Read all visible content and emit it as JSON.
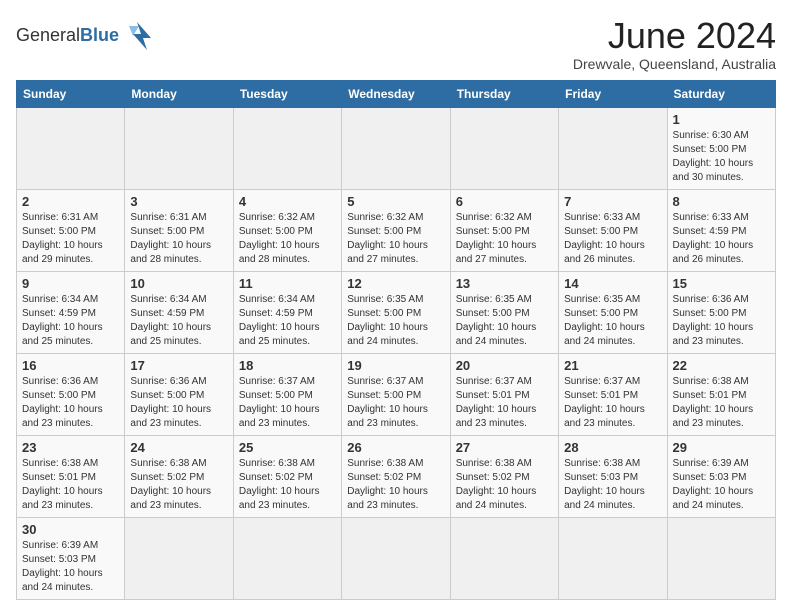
{
  "header": {
    "logo_text_regular": "General",
    "logo_text_bold": "Blue",
    "cal_title": "June 2024",
    "cal_subtitle": "Drewvale, Queensland, Australia"
  },
  "days_of_week": [
    "Sunday",
    "Monday",
    "Tuesday",
    "Wednesday",
    "Thursday",
    "Friday",
    "Saturday"
  ],
  "weeks": [
    [
      {
        "day": "",
        "info": ""
      },
      {
        "day": "",
        "info": ""
      },
      {
        "day": "",
        "info": ""
      },
      {
        "day": "",
        "info": ""
      },
      {
        "day": "",
        "info": ""
      },
      {
        "day": "",
        "info": ""
      },
      {
        "day": "1",
        "info": "Sunrise: 6:30 AM\nSunset: 5:00 PM\nDaylight: 10 hours and 30 minutes."
      }
    ],
    [
      {
        "day": "2",
        "info": "Sunrise: 6:31 AM\nSunset: 5:00 PM\nDaylight: 10 hours and 29 minutes."
      },
      {
        "day": "3",
        "info": "Sunrise: 6:31 AM\nSunset: 5:00 PM\nDaylight: 10 hours and 28 minutes."
      },
      {
        "day": "4",
        "info": "Sunrise: 6:32 AM\nSunset: 5:00 PM\nDaylight: 10 hours and 28 minutes."
      },
      {
        "day": "5",
        "info": "Sunrise: 6:32 AM\nSunset: 5:00 PM\nDaylight: 10 hours and 27 minutes."
      },
      {
        "day": "6",
        "info": "Sunrise: 6:32 AM\nSunset: 5:00 PM\nDaylight: 10 hours and 27 minutes."
      },
      {
        "day": "7",
        "info": "Sunrise: 6:33 AM\nSunset: 5:00 PM\nDaylight: 10 hours and 26 minutes."
      },
      {
        "day": "8",
        "info": "Sunrise: 6:33 AM\nSunset: 4:59 PM\nDaylight: 10 hours and 26 minutes."
      }
    ],
    [
      {
        "day": "9",
        "info": "Sunrise: 6:34 AM\nSunset: 4:59 PM\nDaylight: 10 hours and 25 minutes."
      },
      {
        "day": "10",
        "info": "Sunrise: 6:34 AM\nSunset: 4:59 PM\nDaylight: 10 hours and 25 minutes."
      },
      {
        "day": "11",
        "info": "Sunrise: 6:34 AM\nSunset: 4:59 PM\nDaylight: 10 hours and 25 minutes."
      },
      {
        "day": "12",
        "info": "Sunrise: 6:35 AM\nSunset: 5:00 PM\nDaylight: 10 hours and 24 minutes."
      },
      {
        "day": "13",
        "info": "Sunrise: 6:35 AM\nSunset: 5:00 PM\nDaylight: 10 hours and 24 minutes."
      },
      {
        "day": "14",
        "info": "Sunrise: 6:35 AM\nSunset: 5:00 PM\nDaylight: 10 hours and 24 minutes."
      },
      {
        "day": "15",
        "info": "Sunrise: 6:36 AM\nSunset: 5:00 PM\nDaylight: 10 hours and 23 minutes."
      }
    ],
    [
      {
        "day": "16",
        "info": "Sunrise: 6:36 AM\nSunset: 5:00 PM\nDaylight: 10 hours and 23 minutes."
      },
      {
        "day": "17",
        "info": "Sunrise: 6:36 AM\nSunset: 5:00 PM\nDaylight: 10 hours and 23 minutes."
      },
      {
        "day": "18",
        "info": "Sunrise: 6:37 AM\nSunset: 5:00 PM\nDaylight: 10 hours and 23 minutes."
      },
      {
        "day": "19",
        "info": "Sunrise: 6:37 AM\nSunset: 5:00 PM\nDaylight: 10 hours and 23 minutes."
      },
      {
        "day": "20",
        "info": "Sunrise: 6:37 AM\nSunset: 5:01 PM\nDaylight: 10 hours and 23 minutes."
      },
      {
        "day": "21",
        "info": "Sunrise: 6:37 AM\nSunset: 5:01 PM\nDaylight: 10 hours and 23 minutes."
      },
      {
        "day": "22",
        "info": "Sunrise: 6:38 AM\nSunset: 5:01 PM\nDaylight: 10 hours and 23 minutes."
      }
    ],
    [
      {
        "day": "23",
        "info": "Sunrise: 6:38 AM\nSunset: 5:01 PM\nDaylight: 10 hours and 23 minutes."
      },
      {
        "day": "24",
        "info": "Sunrise: 6:38 AM\nSunset: 5:02 PM\nDaylight: 10 hours and 23 minutes."
      },
      {
        "day": "25",
        "info": "Sunrise: 6:38 AM\nSunset: 5:02 PM\nDaylight: 10 hours and 23 minutes."
      },
      {
        "day": "26",
        "info": "Sunrise: 6:38 AM\nSunset: 5:02 PM\nDaylight: 10 hours and 23 minutes."
      },
      {
        "day": "27",
        "info": "Sunrise: 6:38 AM\nSunset: 5:02 PM\nDaylight: 10 hours and 24 minutes."
      },
      {
        "day": "28",
        "info": "Sunrise: 6:38 AM\nSunset: 5:03 PM\nDaylight: 10 hours and 24 minutes."
      },
      {
        "day": "29",
        "info": "Sunrise: 6:39 AM\nSunset: 5:03 PM\nDaylight: 10 hours and 24 minutes."
      }
    ],
    [
      {
        "day": "30",
        "info": "Sunrise: 6:39 AM\nSunset: 5:03 PM\nDaylight: 10 hours and 24 minutes."
      },
      {
        "day": "",
        "info": ""
      },
      {
        "day": "",
        "info": ""
      },
      {
        "day": "",
        "info": ""
      },
      {
        "day": "",
        "info": ""
      },
      {
        "day": "",
        "info": ""
      },
      {
        "day": "",
        "info": ""
      }
    ]
  ]
}
